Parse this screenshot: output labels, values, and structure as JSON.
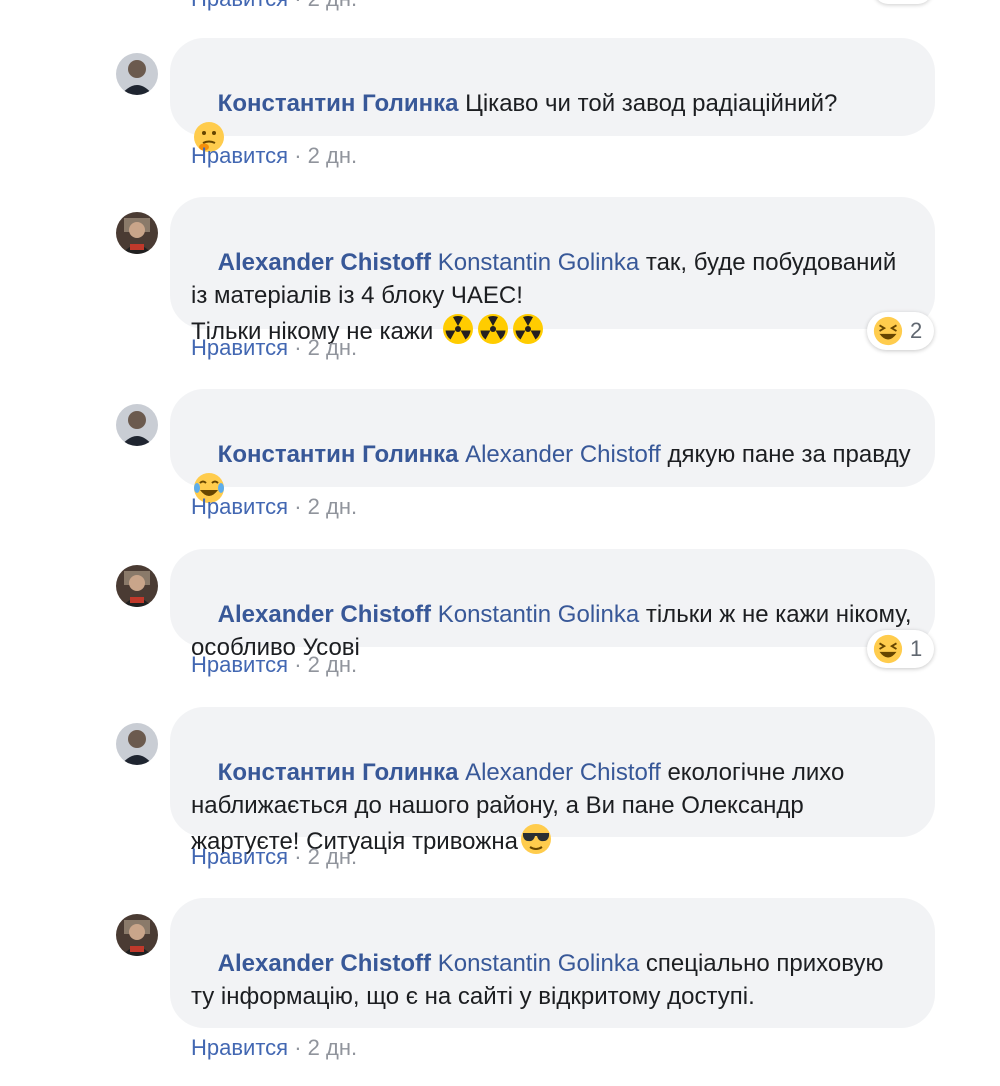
{
  "top_partial": {
    "like_label": "Нравится",
    "separator": " · ",
    "time": "2 дн."
  },
  "comments": [
    {
      "author": "Константин Голинка",
      "mention": "",
      "text": "Цікаво чи той завод радіаційний?\n",
      "emojis": [
        "thinking-emoji"
      ],
      "like_label": "Нравится",
      "separator": " · ",
      "time": "2 дн.",
      "reaction_count": ""
    },
    {
      "author": "Alexander Chistoff",
      "mention": "Konstantin Golinka",
      "text": "так, буде побудований із матеріалів із 4 блоку ЧАЕС!\nТільки нікому не кажи ",
      "emojis": [
        "radioactive-emoji",
        "radioactive-emoji",
        "radioactive-emoji"
      ],
      "like_label": "Нравится",
      "separator": " · ",
      "time": "2 дн.",
      "reaction_count": "2"
    },
    {
      "author": "Константин Голинка",
      "mention": "Alexander Chistoff",
      "text": "дякую пане за правду",
      "emojis": [
        "tears-of-joy-emoji"
      ],
      "like_label": "Нравится",
      "separator": " · ",
      "time": "2 дн.",
      "reaction_count": ""
    },
    {
      "author": "Alexander Chistoff",
      "mention": "Konstantin Golinka",
      "text": "тільки ж не кажи нікому, особливо Усові",
      "emojis": [],
      "like_label": "Нравится",
      "separator": " · ",
      "time": "2 дн.",
      "reaction_count": "1"
    },
    {
      "author": "Константин Голинка",
      "mention": "Alexander Chistoff",
      "text": "екологічне лихо наближається до нашого району, а Ви пане Олександр жартуєте! Ситуація тривожна",
      "emojis": [
        "sunglasses-emoji"
      ],
      "like_label": "Нравится",
      "separator": " · ",
      "time": "2 дн.",
      "reaction_count": ""
    },
    {
      "author": "Alexander Chistoff",
      "mention": "Konstantin Golinka",
      "text": "спеціально приховую ту інформацію, що є на сайті у відкритому доступі.",
      "emojis": [],
      "like_label": "Нравится",
      "separator": " · ",
      "time": "2 дн.",
      "reaction_count": ""
    }
  ],
  "colors": {
    "author_link": "#385898",
    "like_link": "#4267b2",
    "bubble_bg": "#f2f3f5",
    "meta_text": "#90949c"
  },
  "reaction_icon": "laughing-squint-emoji"
}
